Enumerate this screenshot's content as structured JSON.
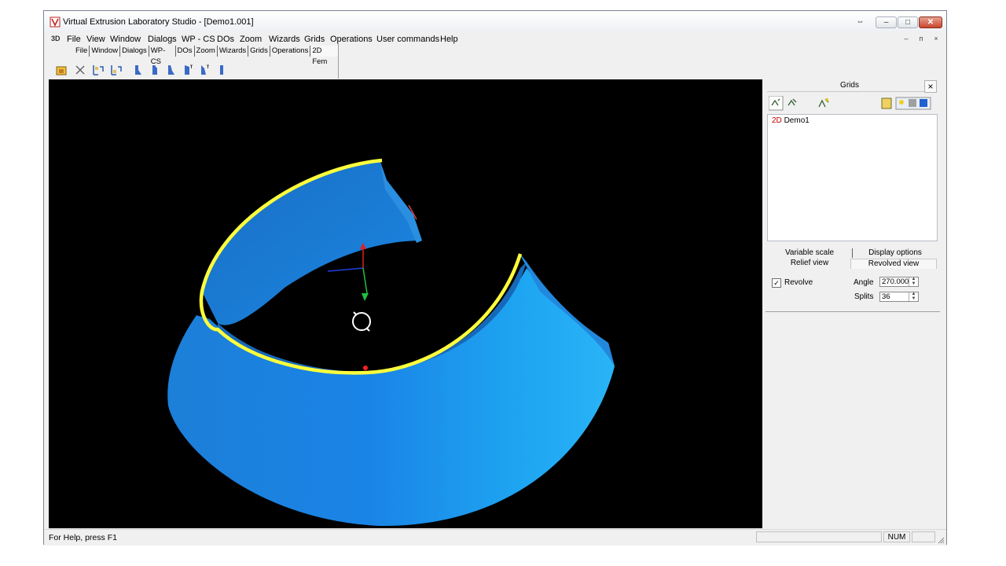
{
  "window": {
    "title": "Virtual Extrusion Laboratory Studio - [Demo1.001]",
    "controls": {
      "extra": "⇔",
      "minimize": "–",
      "maximize": "□",
      "close": "✕"
    }
  },
  "menubar": {
    "app_badge": "3D",
    "items": [
      "File",
      "View",
      "Window",
      "Dialogs",
      "WP - CS",
      "DOs",
      "Zoom",
      "Wizards",
      "Grids",
      "Operations",
      "User commands",
      "Help"
    ],
    "mdi": {
      "minimize": "–",
      "restore": "ᴨ",
      "close": "×"
    }
  },
  "toolbar": {
    "tabs": [
      "File",
      "Window",
      "Dialogs",
      "WP-CS",
      "DOs",
      "Zoom",
      "Wizards",
      "Grids",
      "Operations",
      "2D Fem"
    ],
    "active_tab": "2D Fem"
  },
  "grids_panel": {
    "title": "Grids",
    "close": "×",
    "tree": [
      {
        "prefix": "2D",
        "name": "Demo1"
      }
    ],
    "tabs": {
      "top_left": "Variable scale",
      "top_right": "Display options",
      "bottom_left": "Relief view",
      "bottom_right": "Revolved view"
    },
    "revolve": {
      "label": "Revolve",
      "checked": true,
      "mark": "✓"
    },
    "angle": {
      "label": "Angle",
      "value": "270.000"
    },
    "splits": {
      "label": "Splits",
      "value": "36"
    },
    "spin": {
      "up": "▲",
      "down": "▼"
    }
  },
  "statusbar": {
    "help": "For Help, press F1",
    "num": "NUM"
  },
  "colors": {
    "shape_blue": "#1e8ee6",
    "highlight_yellow": "#ffff3c",
    "viewport_bg": "#000000"
  }
}
